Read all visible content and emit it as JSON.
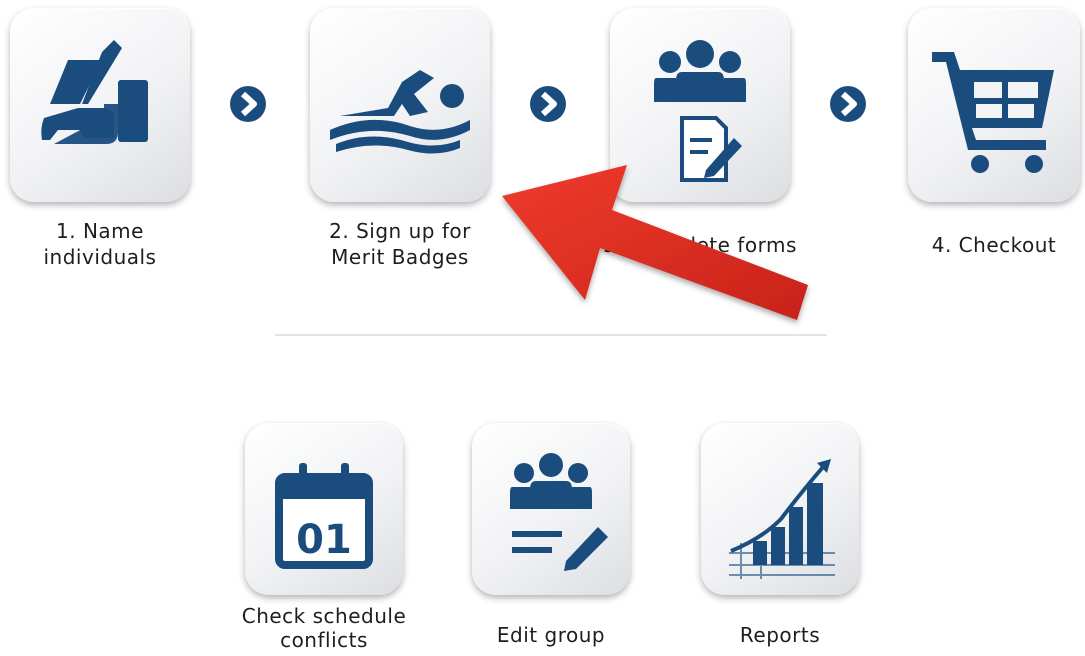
{
  "steps": [
    {
      "label_line1": "1. Name",
      "label_line2": "individuals",
      "icon": "hand-writing-icon"
    },
    {
      "label_line1": "2. Sign up for",
      "label_line2": "Merit Badges",
      "icon": "swimmer-icon"
    },
    {
      "label_line1": "3. Complete forms",
      "label_line2": "",
      "icon": "group-form-icon"
    },
    {
      "label_line1": "4. Checkout",
      "label_line2": "",
      "icon": "shopping-cart-icon"
    }
  ],
  "step_separator_icon": "chevron-right-circle-icon",
  "tools": [
    {
      "label_line1": "Check schedule",
      "label_line2": "conflicts",
      "icon": "calendar-icon",
      "calendar_day": "01"
    },
    {
      "label_line1": "Edit group",
      "label_line2": "",
      "icon": "group-edit-icon"
    },
    {
      "label_line1": "Reports",
      "label_line2": "",
      "icon": "bar-chart-icon"
    }
  ],
  "annotation": {
    "icon": "red-pointer-arrow",
    "color": "#d42a20"
  },
  "colors": {
    "icon_blue": "#1b4c7e",
    "tile_light": "#f3f4f6",
    "tile_shadow": "#c9ccd1"
  }
}
